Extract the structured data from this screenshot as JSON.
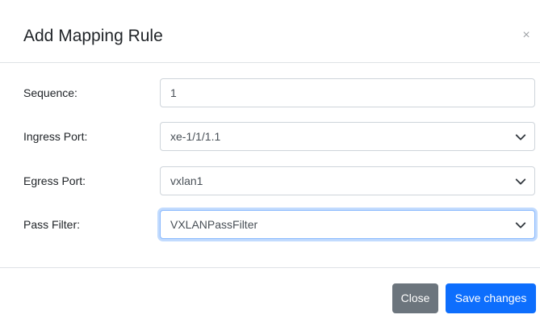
{
  "dialog": {
    "title": "Add Mapping Rule",
    "close_symbol": "×"
  },
  "form": {
    "sequence": {
      "label": "Sequence:",
      "value": "1"
    },
    "ingress_port": {
      "label": "Ingress Port:",
      "value": "xe-1/1/1.1",
      "icon": "chevron-down-icon"
    },
    "egress_port": {
      "label": "Egress Port:",
      "value": "vxlan1",
      "icon": "chevron-down-icon"
    },
    "pass_filter": {
      "label": "Pass Filter:",
      "value": "VXLANPassFilter",
      "icon": "chevron-down-icon"
    }
  },
  "footer": {
    "close_label": "Close",
    "save_label": "Save changes"
  },
  "colors": {
    "primary": "#0d6efd",
    "secondary": "#6c757d",
    "border": "#ced4da",
    "focus_border": "#86b7fe"
  }
}
